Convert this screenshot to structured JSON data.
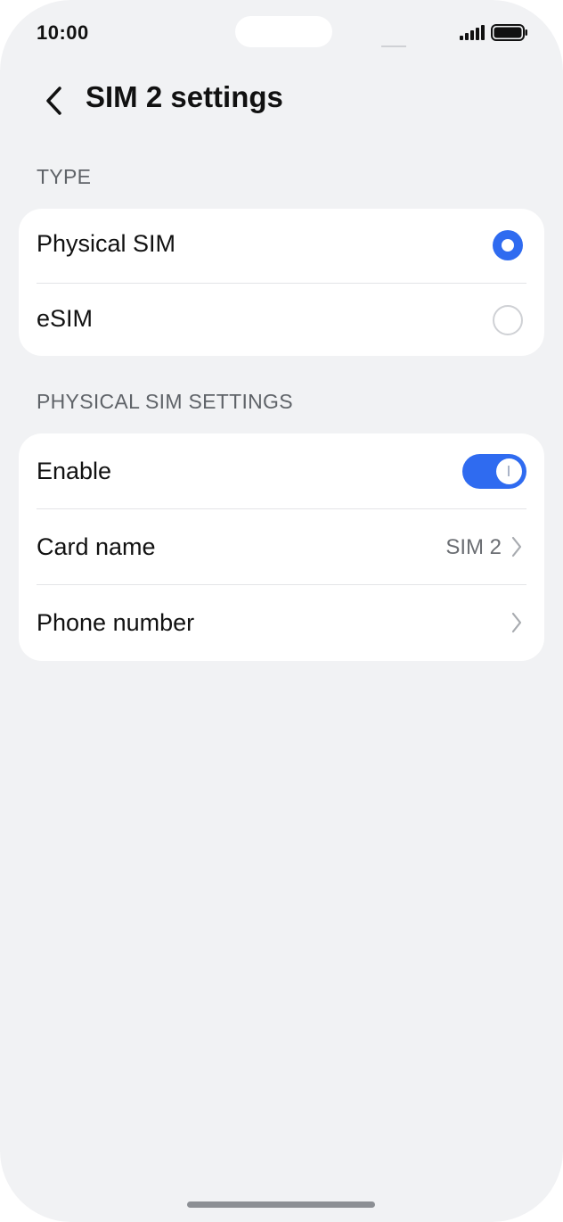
{
  "status": {
    "time": "10:00"
  },
  "header": {
    "title": "SIM 2 settings"
  },
  "sections": {
    "type": {
      "label": "TYPE",
      "options": [
        {
          "label": "Physical SIM",
          "selected": true
        },
        {
          "label": "eSIM",
          "selected": false
        }
      ]
    },
    "physical": {
      "label": "PHYSICAL SIM SETTINGS",
      "enable": {
        "label": "Enable",
        "on": true
      },
      "card_name": {
        "label": "Card name",
        "value": "SIM 2"
      },
      "phone_number": {
        "label": "Phone number"
      }
    }
  },
  "colors": {
    "accent": "#2f6bf0",
    "background": "#f1f2f4",
    "card": "#ffffff"
  },
  "icons": [
    "back-arrow-icon",
    "signal-icon",
    "battery-icon",
    "chevron-right-icon"
  ]
}
